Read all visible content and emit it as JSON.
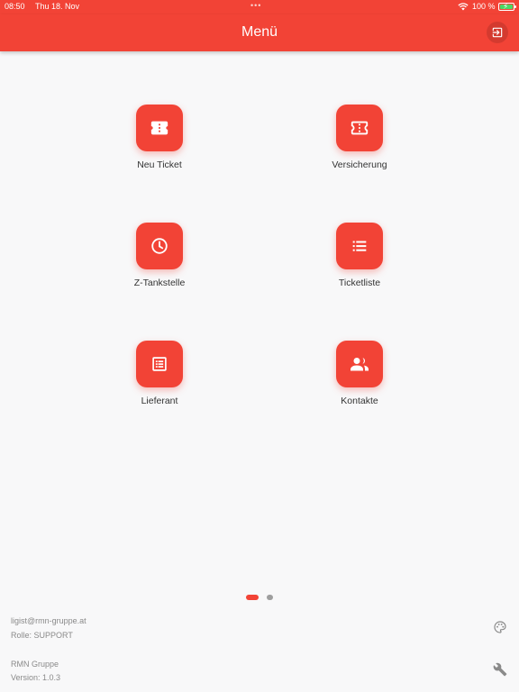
{
  "status_bar": {
    "time": "08:50",
    "date": "Thu 18. Nov",
    "battery": "100 %"
  },
  "app_bar": {
    "title": "Menü",
    "logout_icon": "logout-icon"
  },
  "menu": {
    "items": [
      {
        "label": "Neu Ticket",
        "icon": "ticket-icon"
      },
      {
        "label": "Versicherung",
        "icon": "ticket-outline-icon"
      },
      {
        "label": "Z-Tankstelle",
        "icon": "clock-icon"
      },
      {
        "label": "Ticketliste",
        "icon": "list-icon"
      },
      {
        "label": "Lieferant",
        "icon": "receipt-list-icon"
      },
      {
        "label": "Kontakte",
        "icon": "people-icon"
      }
    ]
  },
  "pager": {
    "page": 1,
    "pages": 2
  },
  "footer": {
    "user_email": "ligist@rmn-gruppe.at",
    "role": "Rolle: SUPPORT",
    "company": "RMN Gruppe",
    "version": "Version: 1.0.3"
  },
  "colors": {
    "primary": "#f24336",
    "background": "#f8f8f9",
    "footer_text": "#8a8a8a"
  }
}
